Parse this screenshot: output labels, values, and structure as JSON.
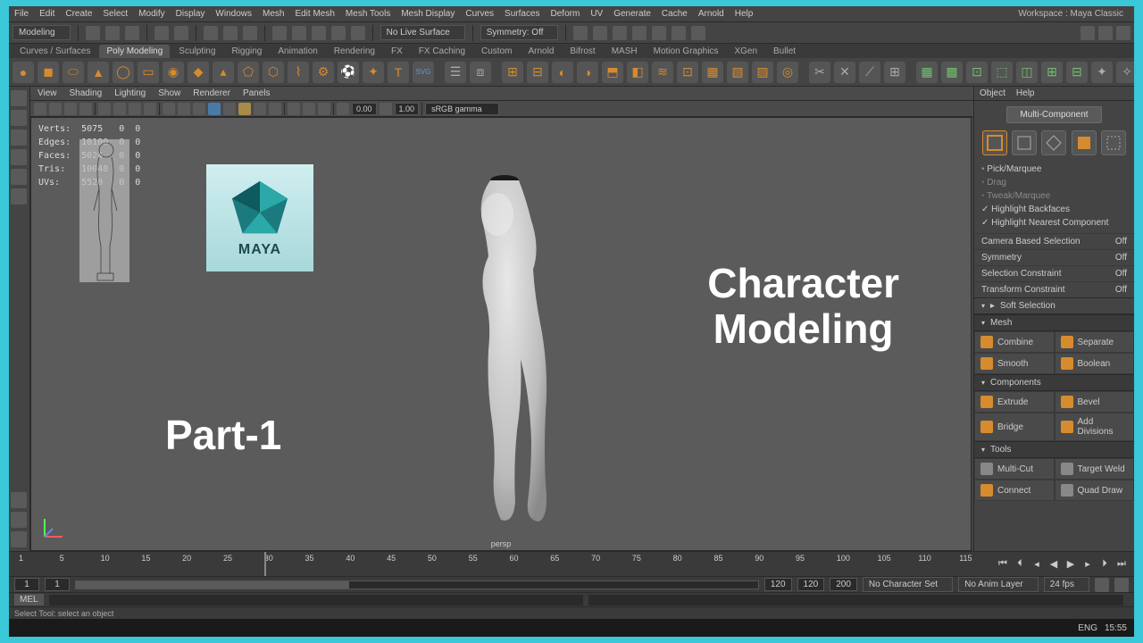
{
  "menubar": [
    "File",
    "Edit",
    "Create",
    "Select",
    "Modify",
    "Display",
    "Windows",
    "Mesh",
    "Edit Mesh",
    "Mesh Tools",
    "Mesh Display",
    "Curves",
    "Surfaces",
    "Deform",
    "UV",
    "Generate",
    "Cache",
    "Arnold",
    "Help"
  ],
  "workspace_label": "Workspace :",
  "workspace_value": "Maya Classic",
  "mode_dropdown": "Modeling",
  "live_surface": "No Live Surface",
  "symmetry": "Symmetry: Off",
  "shelfTabs": [
    "Curves / Surfaces",
    "Poly Modeling",
    "Sculpting",
    "Rigging",
    "Animation",
    "Rendering",
    "FX",
    "FX Caching",
    "Custom",
    "Arnold",
    "Bifrost",
    "MASH",
    "Motion Graphics",
    "XGen",
    "Bullet"
  ],
  "shelfActive": "Poly Modeling",
  "viewMenu": [
    "View",
    "Shading",
    "Lighting",
    "Show",
    "Renderer",
    "Panels"
  ],
  "gamma": "sRGB gamma",
  "numA": "0.00",
  "numB": "1.00",
  "hud": {
    "rows": [
      {
        "k": "Verts:",
        "a": "5075",
        "b": "0",
        "c": "0"
      },
      {
        "k": "Edges:",
        "a": "10100",
        "b": "0",
        "c": "0"
      },
      {
        "k": "Faces:",
        "a": "5024",
        "b": "0",
        "c": "0"
      },
      {
        "k": "Tris:",
        "a": "10048",
        "b": "0",
        "c": "0"
      },
      {
        "k": "UVs:",
        "a": "5520",
        "b": "0",
        "c": "0"
      }
    ]
  },
  "mayaLabel": "MAYA",
  "overlay": {
    "char": "Character\nModeling",
    "part": "Part-1"
  },
  "persp": "persp",
  "rp": {
    "menu": [
      "Object",
      "Help"
    ],
    "multi": "Multi-Component",
    "opts": [
      {
        "t": "Pick/Marquee",
        "c": "dot"
      },
      {
        "t": "Drag",
        "c": "none"
      },
      {
        "t": "Tweak/Marquee",
        "c": "none"
      },
      {
        "t": "Highlight Backfaces",
        "c": "check"
      },
      {
        "t": "Highlight Nearest Component",
        "c": "check"
      }
    ],
    "settings": [
      {
        "k": "Camera Based Selection",
        "v": "Off"
      },
      {
        "k": "Symmetry",
        "v": "Off"
      },
      {
        "k": "Selection Constraint",
        "v": "Off"
      },
      {
        "k": "Transform Constraint",
        "v": "Off"
      }
    ],
    "soft": "Soft Selection",
    "mesh": {
      "h": "Mesh",
      "items": [
        "Combine",
        "Separate",
        "Smooth",
        "Boolean"
      ]
    },
    "comp": {
      "h": "Components",
      "items": [
        "Extrude",
        "Bevel",
        "Bridge",
        "Add Divisions"
      ]
    },
    "tools": {
      "h": "Tools",
      "items": [
        "Multi-Cut",
        "Target Weld",
        "Connect",
        "Quad Draw"
      ]
    }
  },
  "timeline": {
    "ticks": [
      "1",
      "5",
      "10",
      "15",
      "20",
      "25",
      "30",
      "35",
      "40",
      "45",
      "50",
      "55",
      "60",
      "65",
      "70",
      "75",
      "80",
      "85",
      "90",
      "95",
      "100",
      "105",
      "110",
      "115"
    ],
    "current": 30
  },
  "range": {
    "start": "1",
    "startIn": "1",
    "endIn": "120",
    "end": "120",
    "end2": "200",
    "charset": "No Character Set",
    "animlayer": "No Anim Layer",
    "fps": "24 fps"
  },
  "cmd": "MEL",
  "helpline": "Select Tool: select an object",
  "taskbar": {
    "lang": "ENG",
    "time": "15:55"
  }
}
